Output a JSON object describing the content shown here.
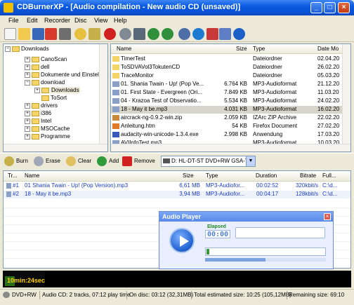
{
  "window": {
    "title": "CDBurnerXP - [Audio compilation - New audio CD (unsaved)]"
  },
  "menu": [
    "File",
    "Edit",
    "Recorder",
    "Disc",
    "View",
    "Help"
  ],
  "toolbar_icons": [
    "new-icon",
    "open-icon",
    "save-icon",
    "delete-icon",
    "print-icon",
    "add-icon",
    "burn-icon",
    "settings-icon",
    "globe-icon",
    "help-icon",
    "info-icon"
  ],
  "tree": {
    "root": "Downloads",
    "items": [
      {
        "label": "CanoScan",
        "expander": "+"
      },
      {
        "label": "dell",
        "expander": "+"
      },
      {
        "label": "Dokumente und Einstellungen",
        "expander": "+"
      },
      {
        "label": "download",
        "expander": "−"
      },
      {
        "label": "Downloads",
        "expander": "+"
      },
      {
        "label": "ToSort",
        "expander": ""
      },
      {
        "label": "drivers",
        "expander": "+"
      },
      {
        "label": "i386",
        "expander": "+"
      },
      {
        "label": "Intel",
        "expander": "+"
      },
      {
        "label": "MSOCache",
        "expander": "+"
      },
      {
        "label": "Programme",
        "expander": "+"
      }
    ]
  },
  "file_list": {
    "columns": {
      "name": "Name",
      "size": "Size",
      "type": "Type",
      "date": "Date Mo"
    },
    "rows": [
      {
        "name": "TimerTest",
        "size": "",
        "type": "Dateiordner",
        "date": "02.04.20"
      },
      {
        "name": "ToSDVAVol3TokutenCD",
        "size": "",
        "type": "Dateiordner",
        "date": "26.02.20"
      },
      {
        "name": "TraceMonitor",
        "size": "",
        "type": "Dateiordner",
        "date": "05.03.20"
      },
      {
        "name": "01. Shania Twain - Up! (Pop Ve...",
        "size": "6.764 KB",
        "type": "MP3-Audioformat",
        "date": "21.12.20"
      },
      {
        "name": "01. First State - Evergreen (Ori...",
        "size": "7.849 KB",
        "type": "MP3-Audioformat",
        "date": "11.03.20"
      },
      {
        "name": "04 - Krazoa Test of Observatio...",
        "size": "5.534 KB",
        "type": "MP3-Audioformat",
        "date": "24.02.20"
      },
      {
        "name": "18 - May it be.mp3",
        "size": "4.031 KB",
        "type": "MP3-Audioformat",
        "date": "16.02.20"
      },
      {
        "name": "aircrack-ng-0.9.2-win.zip",
        "size": "2.059 KB",
        "type": "IZArc ZIP Archive",
        "date": "22.02.20"
      },
      {
        "name": "Anleitung.htm",
        "size": "54 KB",
        "type": "Firefox Document",
        "date": "27.02.20"
      },
      {
        "name": "audacity-win-unicode-1.3.4.exe",
        "size": "2.998 KB",
        "type": "Anwendung",
        "date": "17.03.20"
      },
      {
        "name": "AVIInfoTest.mp3",
        "size": "",
        "type": "MP3-Audioformat",
        "date": "10.03.20"
      }
    ]
  },
  "actions": {
    "burn": "Burn",
    "erase": "Erase",
    "clear": "Clear",
    "add": "Add",
    "remove": "Remove",
    "drive": "D: HL-DT-ST DVD+RW GSA-T21N"
  },
  "compilation": {
    "columns": {
      "track": "Tr...",
      "name": "Name",
      "size": "Size",
      "type": "Type",
      "duration": "Duration",
      "bitrate": "Bitrate",
      "full": "Full..."
    },
    "rows": [
      {
        "track": "#1",
        "name": "01 Shania Twain - Up! (Pop Version).mp3",
        "size": "6,61 MB",
        "type": "MP3-Audiofor...",
        "duration": "00:02:52",
        "bitrate": "320kbit/s",
        "full": "C:\\d..."
      },
      {
        "track": "#2",
        "name": "18 - May it be.mp3",
        "size": "3,94 MB",
        "type": "MP3-Audiofor...",
        "duration": "00:04:17",
        "bitrate": "128kbit/s",
        "full": "C:\\d..."
      }
    ]
  },
  "capacity": {
    "time_label": "10min:24sec",
    "fill_fraction": 0.12
  },
  "status": {
    "media": "DVD+RW",
    "audio": "Audio CD: 2 tracks, 07:12 play time",
    "on_disc": "On disc: 03:12 (32,31MB)",
    "total": "Total estimated size: 10:25 (105,12MB)",
    "remaining": "Remaining size: 69:10"
  },
  "player": {
    "title": "Audio Player",
    "elapsed_label": "Elapsed",
    "elapsed": "00:00",
    "volume_fraction": 0.5
  },
  "colors": {
    "titlebar": "#0a5ae0",
    "accent": "#1a3cc8",
    "capacity_text": "#ffd200"
  }
}
